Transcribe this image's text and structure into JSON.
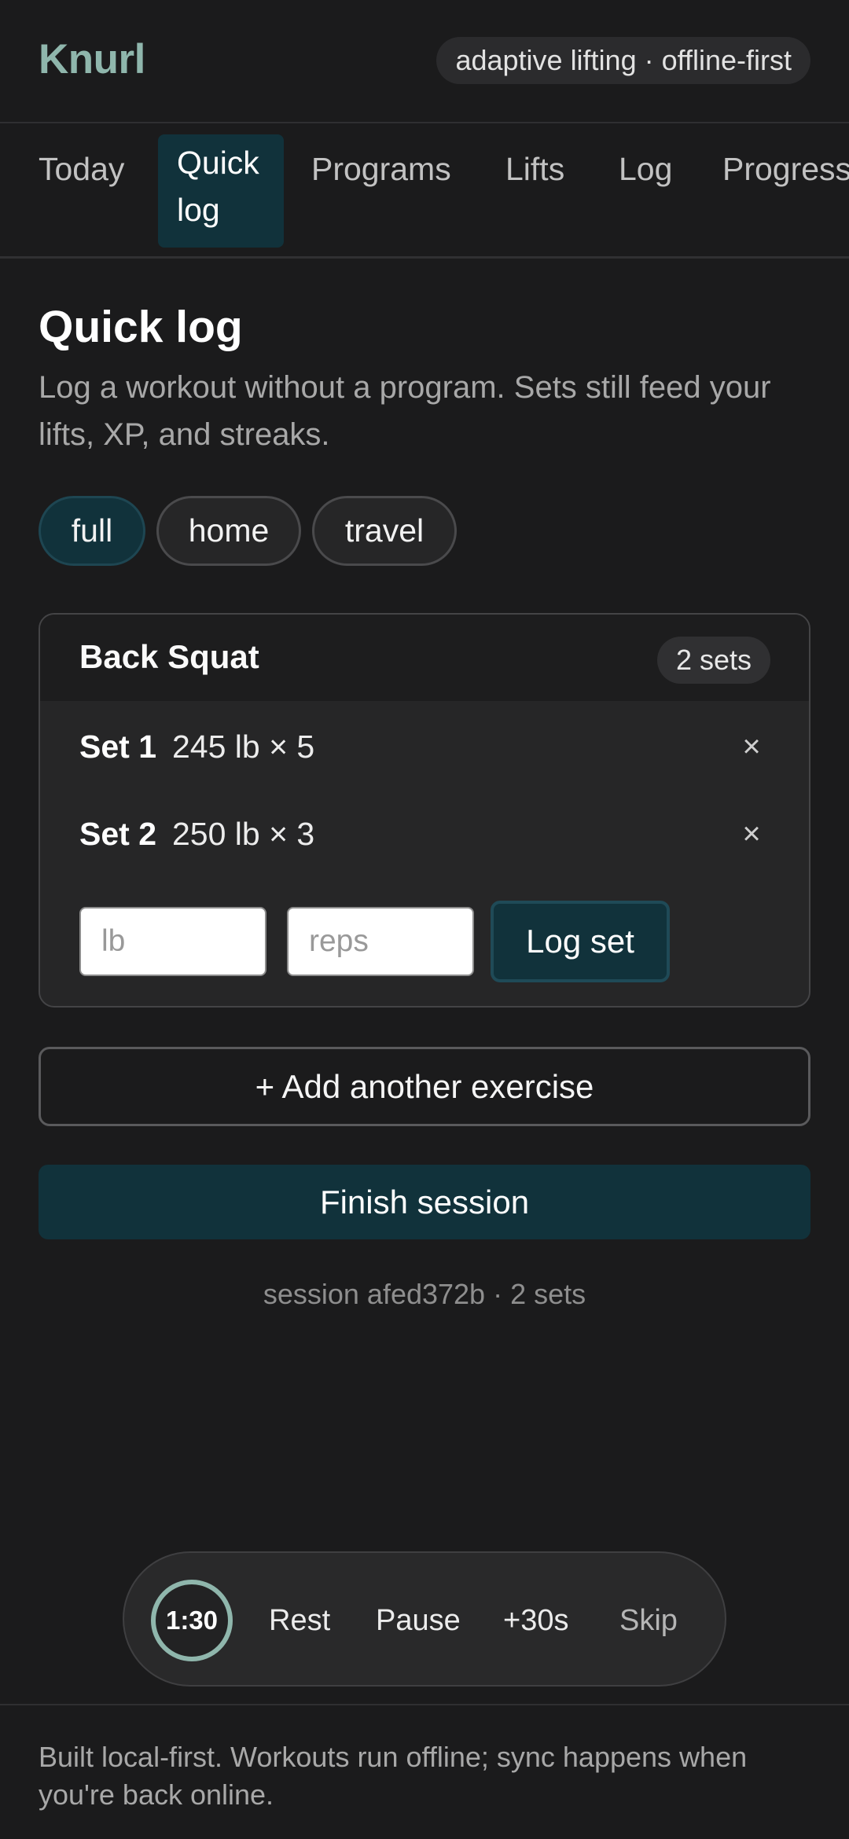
{
  "header": {
    "brand": "Knurl",
    "tagline": "adaptive lifting · offline-first"
  },
  "nav": {
    "tabs": [
      {
        "label": "Today",
        "active": false
      },
      {
        "label": "Quick log",
        "active": true
      },
      {
        "label": "Programs",
        "active": false
      },
      {
        "label": "Lifts",
        "active": false
      },
      {
        "label": "Log",
        "active": false
      },
      {
        "label": "Progress",
        "active": false
      }
    ]
  },
  "page": {
    "title": "Quick log",
    "subtitle": "Log a workout without a program. Sets still feed your lifts, XP, and streaks."
  },
  "chips": [
    {
      "label": "full",
      "active": true
    },
    {
      "label": "home",
      "active": false
    },
    {
      "label": "travel",
      "active": false
    }
  ],
  "exercise": {
    "name": "Back Squat",
    "sets_badge": "2 sets",
    "sets": [
      {
        "label": "Set 1",
        "value": "245 lb × 5"
      },
      {
        "label": "Set 2",
        "value": "250 lb × 3"
      }
    ],
    "remove_glyph": "×",
    "weight_placeholder": "lb",
    "reps_placeholder": "reps",
    "log_button": "Log set"
  },
  "actions": {
    "add_exercise": "+ Add another exercise",
    "finish": "Finish session"
  },
  "session_meta": "session afed372b · 2 sets",
  "timer": {
    "time": "1:30",
    "rest": "Rest",
    "pause": "Pause",
    "plus": "+30s",
    "skip": "Skip"
  },
  "footer": {
    "text": "Built local-first. Workouts run offline; sync happens when you're back online."
  },
  "colors": {
    "background": "#1b1b1c",
    "brand": "#8fb6ac",
    "accent": "#11323b"
  }
}
